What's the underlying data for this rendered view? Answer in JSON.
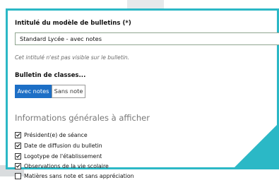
{
  "form": {
    "title_label": "Intitulé du modèle de bulletins (*)",
    "title_value": "Standard Lycée - avec notes",
    "title_hint": "Cet intitulé n'est pas visible sur le bulletin.",
    "bulletin_label": "Bulletin de classes...",
    "toggle": {
      "selected": "Avec notes",
      "options": [
        "Avec notes",
        "Sans note"
      ]
    },
    "general_info_title": "Informations générales à afficher",
    "checkboxes": [
      {
        "label": "Président(e) de séance",
        "checked": true
      },
      {
        "label": "Date de diffusion du bulletin",
        "checked": true
      },
      {
        "label": "Logotype de l'établissement",
        "checked": true
      },
      {
        "label": "Observations de la vie scolaire",
        "checked": true
      },
      {
        "label": "Matières sans note et sans appréciation",
        "checked": false
      }
    ]
  },
  "colors": {
    "accent_frame": "#2bb8c6",
    "toggle_active": "#1d6fc6"
  }
}
